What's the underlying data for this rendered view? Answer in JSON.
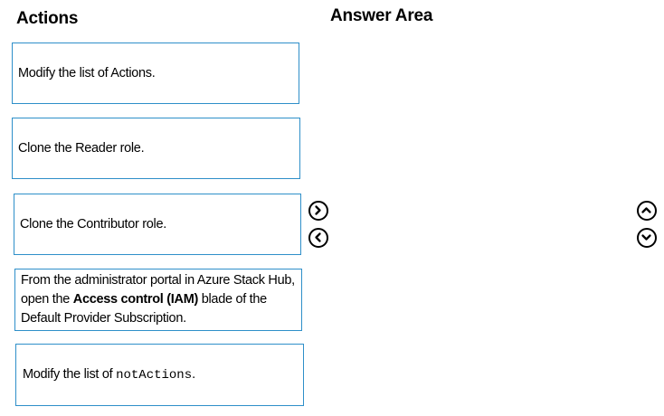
{
  "actions": {
    "heading": "Actions",
    "items": [
      {
        "text": "Modify the list of Actions."
      },
      {
        "text": "Clone the Reader role."
      },
      {
        "text": "Clone the Contributor role."
      },
      {
        "prefix": "From the administrator portal in Azure Stack Hub, open the ",
        "bold": "Access control (IAM)",
        "suffix": " blade of the Default Provider Subscription."
      },
      {
        "prefix": "Modify the list of ",
        "code": "notActions",
        "suffix": "."
      }
    ]
  },
  "answer_area": {
    "heading": "Answer Area"
  },
  "controls": {
    "move_right_icon": "chevron-right-circle-icon",
    "move_left_icon": "chevron-left-circle-icon",
    "move_up_icon": "chevron-up-circle-icon",
    "move_down_icon": "chevron-down-circle-icon"
  }
}
